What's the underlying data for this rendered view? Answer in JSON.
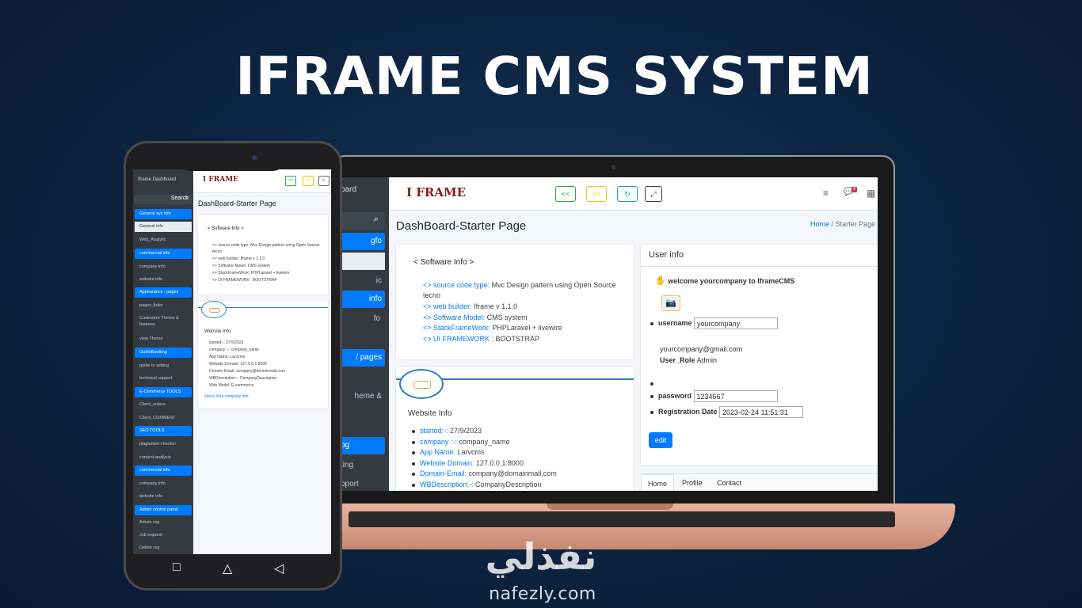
{
  "hero": {
    "title": "IFRAME CMS SYSTEM"
  },
  "laptop": {
    "sidebar": {
      "header": "oard",
      "items": [
        {
          "label": "gfo"
        },
        {
          "label": "ic"
        },
        {
          "label": "info"
        },
        {
          "label": "fo"
        },
        {
          "label": "/ pages"
        },
        {
          "label": "heme &"
        },
        {
          "label": "pg"
        },
        {
          "label": "ting"
        },
        {
          "label": "pport"
        }
      ]
    },
    "topbar": {
      "logo": "I FRAME",
      "buttons": [
        "<<",
        ">>",
        "↻",
        "⤢"
      ],
      "menu_icon": "≡",
      "chat_icon": "💬",
      "chat_badge": "4",
      "grid_icon": "▦"
    },
    "page_title": "DashBoard-Starter Page",
    "breadcrumb": {
      "home": "Home",
      "sep": "/",
      "current": "Starter Page"
    },
    "software_info": {
      "title": "< Software Info >",
      "lines": [
        {
          "arrow": "<>",
          "key": "source code type:",
          "value": "Mvc Design pattern using Open Source"
        },
        {
          "arrow": "",
          "key": "",
          "value": "tecno"
        },
        {
          "arrow": "<>",
          "key": "web builder:",
          "value": "Iframe v 1.1.0"
        },
        {
          "arrow": "<>",
          "key": "Software Model:",
          "value": "CMS system"
        },
        {
          "arrow": "<>",
          "key": "StackFrameWork:",
          "value": "PHPLaravel + livewire"
        },
        {
          "arrow": "<>",
          "key": "UI FRAMEWORK :",
          "value": "BOOTSTRAP"
        }
      ]
    },
    "website_info": {
      "title": "Website Info",
      "lines": [
        {
          "key": "started:-:",
          "value": "27/9/2023"
        },
        {
          "key": "company :-:",
          "value": "company_name"
        },
        {
          "key": "App Name:",
          "value": "Larvcms"
        },
        {
          "key": "Website Domain:",
          "value": "127.0.0.1:8000"
        },
        {
          "key": "Domain-Email:",
          "value": "company@domainmail.com"
        },
        {
          "key": "WBDescription:-:",
          "value": "CompanyDescription"
        }
      ]
    },
    "user_info": {
      "title": "User info",
      "welcome": "welcome yourcompany to IframeCMS",
      "username_label": "username",
      "username_value": "yourcompany",
      "email": "yourcompany@gmail.com",
      "role_label": "User_Role",
      "role_value": "Admin",
      "password_label": "password",
      "password_value": "1234567",
      "reg_label": "Registration Date",
      "reg_value": "2023-02-24 11:51:31",
      "edit_label": "edit",
      "tabs": [
        "Home",
        "Profile",
        "Contact"
      ]
    }
  },
  "phone": {
    "sidebar": {
      "header": "Iframe Dashboard",
      "search_placeholder": "Search",
      "items": [
        {
          "label": "General sys info"
        },
        {
          "label": "General info"
        },
        {
          "label": "Web_Analytic"
        },
        {
          "label": "commercial info"
        },
        {
          "label": "company info"
        },
        {
          "label": "website info"
        },
        {
          "label": "Appearance / pages"
        },
        {
          "label": "pages_links"
        },
        {
          "label": "Customize Theme & features"
        },
        {
          "label": "view Theme"
        },
        {
          "label": "GuideBootting"
        },
        {
          "label": "guide to setting"
        },
        {
          "label": "technical support"
        },
        {
          "label": "E-Commerce TOOLS"
        },
        {
          "label": "Client_orders"
        },
        {
          "label": "Client_COMMENT"
        },
        {
          "label": "SEO TOOLS"
        },
        {
          "label": "plagiarism-checker"
        },
        {
          "label": "content-analysis"
        },
        {
          "label": "commercial info"
        },
        {
          "label": "company info"
        },
        {
          "label": "website info"
        },
        {
          "label": "Admin control panel"
        },
        {
          "label": "Admin reg"
        },
        {
          "label": "Job request"
        },
        {
          "label": "Delete reg"
        }
      ]
    },
    "topbar": {
      "logo": "I FRAME",
      "buttons": [
        "<<",
        ">>",
        "↻"
      ]
    },
    "page_title": "DashBoard-Starter Page",
    "software_info": {
      "title": "< Software Info >",
      "lines": [
        "<> source code type: Mvc Design pattern using Open Source",
        "tecno",
        "<> web builder: Iframe v 1.1.0",
        "<> Software Model: CMS system",
        "<> StackFrameWork: PHPLaravel + livewire",
        "<> UI FRAMEWORK : BOOTSTRAP"
      ]
    },
    "website_info": {
      "title": "Website Info",
      "lines": [
        "started:-: 27/9/2023",
        "company :-: company_name",
        "App Name: Larvcms",
        "Website Domain: 127.0.0.1:8000",
        "Domain-Email: company@domainmail.com",
        "WBDescription:-: CompanyDescription",
        "Web Model: E-commerce"
      ],
      "link": "check Your company info"
    },
    "navbar": [
      "□",
      "△",
      "◁"
    ]
  },
  "watermark": {
    "arabic": "نفذلي",
    "latin": "nafezly.com"
  }
}
